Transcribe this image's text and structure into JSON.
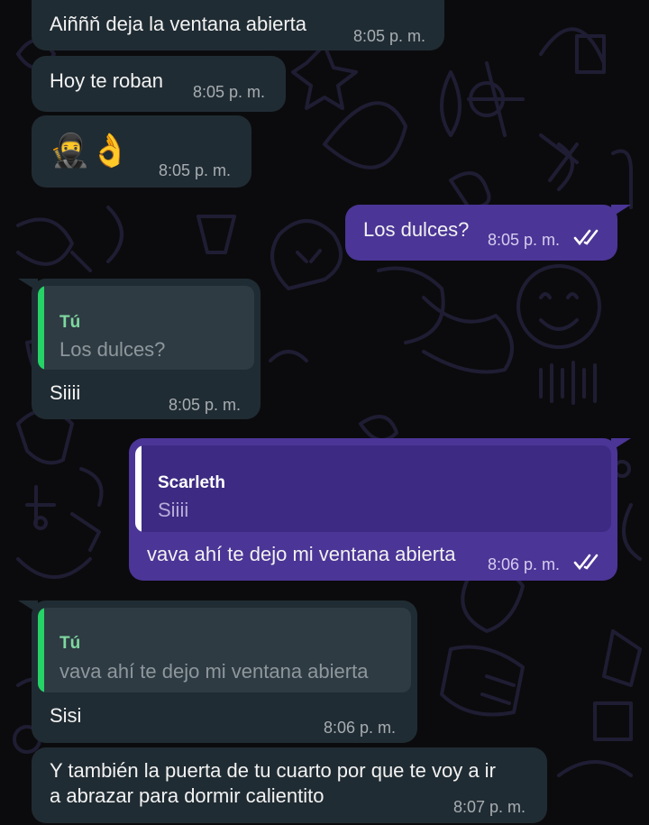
{
  "messages": [
    {
      "text": "Aiññň deja  la ventana abierta",
      "time": "8:05 p. m."
    },
    {
      "text": "Hoy te roban",
      "time": "8:05 p. m."
    },
    {
      "emoji": "🥷👌",
      "time": "8:05 p. m."
    },
    {
      "text": "Los dulces?",
      "time": "8:05 p. m.",
      "status": "read-double-check-icon"
    },
    {
      "quote": {
        "author": "Tú",
        "text": "Los dulces?"
      },
      "text": "Siiii",
      "time": "8:05 p. m."
    },
    {
      "quote": {
        "author": "Scarleth",
        "text": "Siiii"
      },
      "text": "vava ahí te dejo mi ventana abierta",
      "time": "8:06 p. m.",
      "status": "read-double-check-icon"
    },
    {
      "quote": {
        "author": "Tú",
        "text": "vava ahí te dejo mi ventana abierta"
      },
      "text": "Sisi",
      "time": "8:06 p. m."
    },
    {
      "text_lines": [
        "Y también la puerta de tu cuarto  por que te voy a ir",
        "a abrazar para dormir calientito"
      ],
      "time": "8:07 p. m."
    }
  ],
  "colors": {
    "incoming_bubble": "#202c33",
    "outgoing_bubble": "#4b3596",
    "quote_author_self": "#7fd9a0",
    "quote_bar_self": "#25d366",
    "quote_bar_contact": "#ffffff"
  }
}
